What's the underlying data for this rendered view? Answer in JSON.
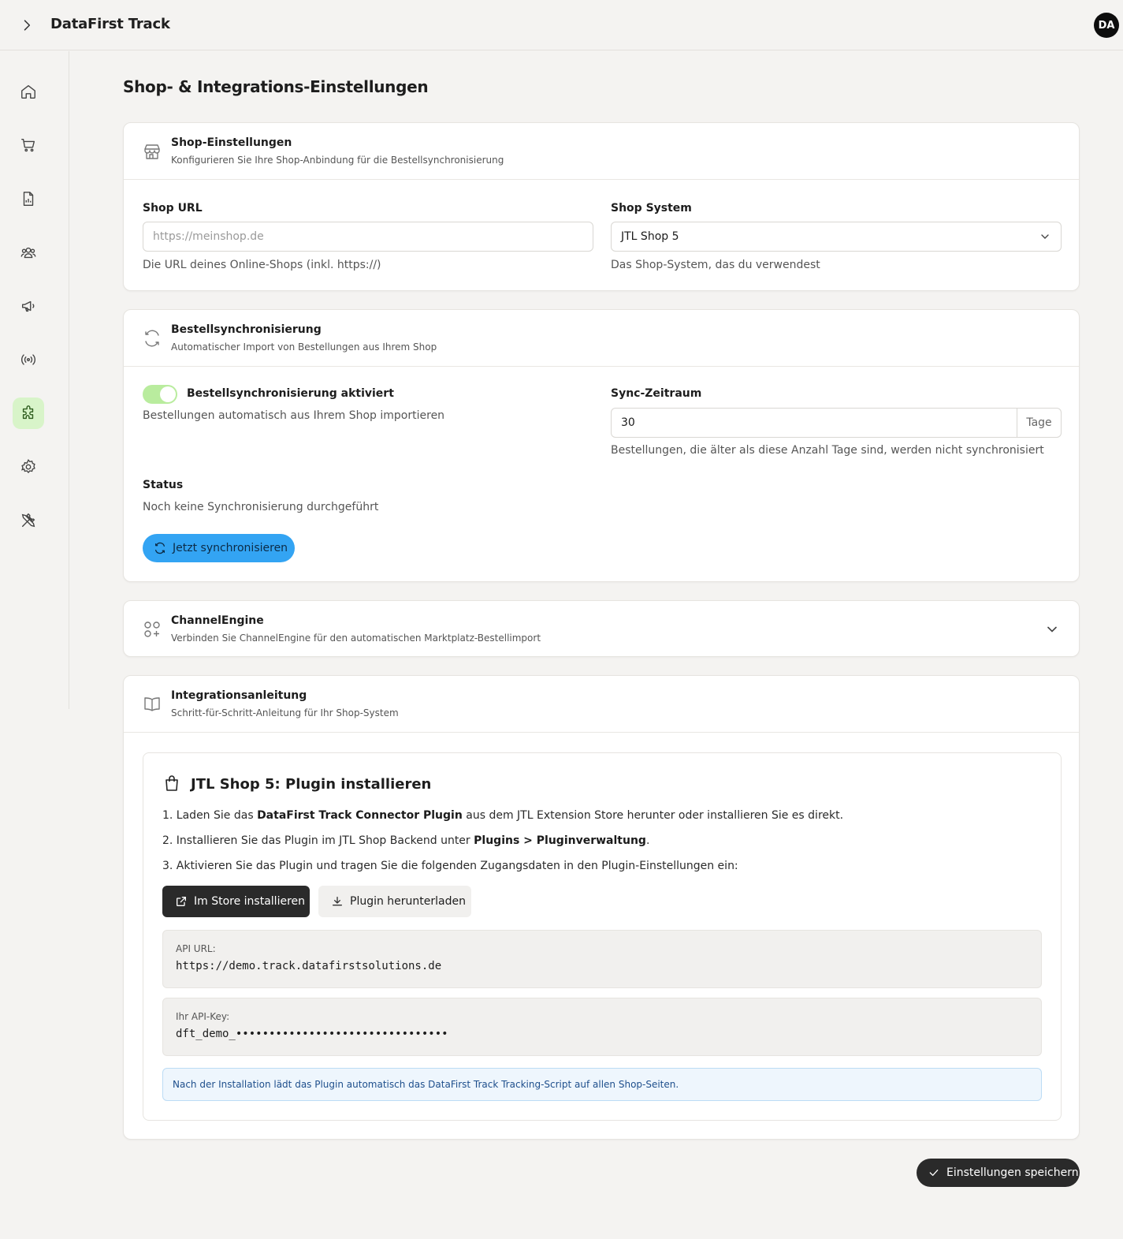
{
  "app": {
    "title": "DataFirst Track",
    "avatar_initials": "DA"
  },
  "sidebar": {
    "items": [
      {
        "name": "home",
        "icon": "home-icon",
        "active": false
      },
      {
        "name": "orders",
        "icon": "cart-icon",
        "active": false
      },
      {
        "name": "reports",
        "icon": "report-icon",
        "active": false
      },
      {
        "name": "customers",
        "icon": "users-icon",
        "active": false
      },
      {
        "name": "campaigns",
        "icon": "megaphone-icon",
        "active": false
      },
      {
        "name": "tracking",
        "icon": "broadcast-icon",
        "active": false
      },
      {
        "name": "integrations",
        "icon": "puzzle-icon",
        "active": true
      },
      {
        "name": "settings",
        "icon": "gear-icon",
        "active": false
      },
      {
        "name": "tools",
        "icon": "tools-icon",
        "active": false
      }
    ],
    "active_color": "#d8f4c9"
  },
  "page": {
    "title": "Shop- & Integrations-Einstellungen"
  },
  "shop_settings": {
    "title": "Shop-Einstellungen",
    "subtitle": "Konfigurieren Sie Ihre Shop-Anbindung für die Bestellsynchronisierung",
    "url_label": "Shop URL",
    "url_placeholder": "https://meinshop.de",
    "url_value": "",
    "url_hint": "Die URL deines Online-Shops (inkl. https://)",
    "system_label": "Shop System",
    "system_value": "JTL Shop 5",
    "system_hint": "Das Shop-System, das du verwendest"
  },
  "order_sync": {
    "title": "Bestellsynchronisierung",
    "subtitle": "Automatischer Import von Bestellungen aus Ihrem Shop",
    "toggle_label": "Bestellsynchronisierung aktiviert",
    "toggle_on": true,
    "toggle_hint": "Bestellungen automatisch aus Ihrem Shop importieren",
    "period_label": "Sync-Zeitraum",
    "period_value": "30",
    "period_unit": "Tage",
    "period_hint": "Bestellungen, die älter als diese Anzahl Tage sind, werden nicht synchronisiert",
    "status_label": "Status",
    "status_value": "Noch keine Synchronisierung durchgeführt",
    "sync_button": "Jetzt synchronisieren",
    "sync_button_color": "#33a4f3"
  },
  "channel_engine": {
    "title": "ChannelEngine",
    "subtitle": "Verbinden Sie ChannelEngine für den automatischen Marktplatz-Bestellimport"
  },
  "guide": {
    "title": "Integrationsanleitung",
    "subtitle": "Schritt-für-Schritt-Anleitung für Ihr Shop-System",
    "section_title": "JTL Shop 5: Plugin installieren",
    "step1_a": "1. Laden Sie das ",
    "step1_b": "DataFirst Track Connector Plugin",
    "step1_c": " aus dem JTL Extension Store herunter oder installieren Sie es direkt.",
    "step2_a": "2. Installieren Sie das Plugin im JTL Shop Backend unter ",
    "step2_b": "Plugins > Pluginverwaltung",
    "step2_c": ".",
    "step3": "3. Aktivieren Sie das Plugin und tragen Sie die folgenden Zugangsdaten in den Plugin-Einstellungen ein:",
    "store_button": "Im Store installieren",
    "download_button": "Plugin herunterladen",
    "api_url_label": "API URL:",
    "api_url_value": "https://demo.track.datafirstsolutions.de",
    "api_key_label": "Ihr API-Key:",
    "api_key_value": "dft_demo_••••••••••••••••••••••••••••••••",
    "info_text": "Nach der Installation lädt das Plugin automatisch das DataFirst Track Tracking-Script auf allen Shop-Seiten."
  },
  "footer": {
    "save_button": "Einstellungen speichern"
  }
}
